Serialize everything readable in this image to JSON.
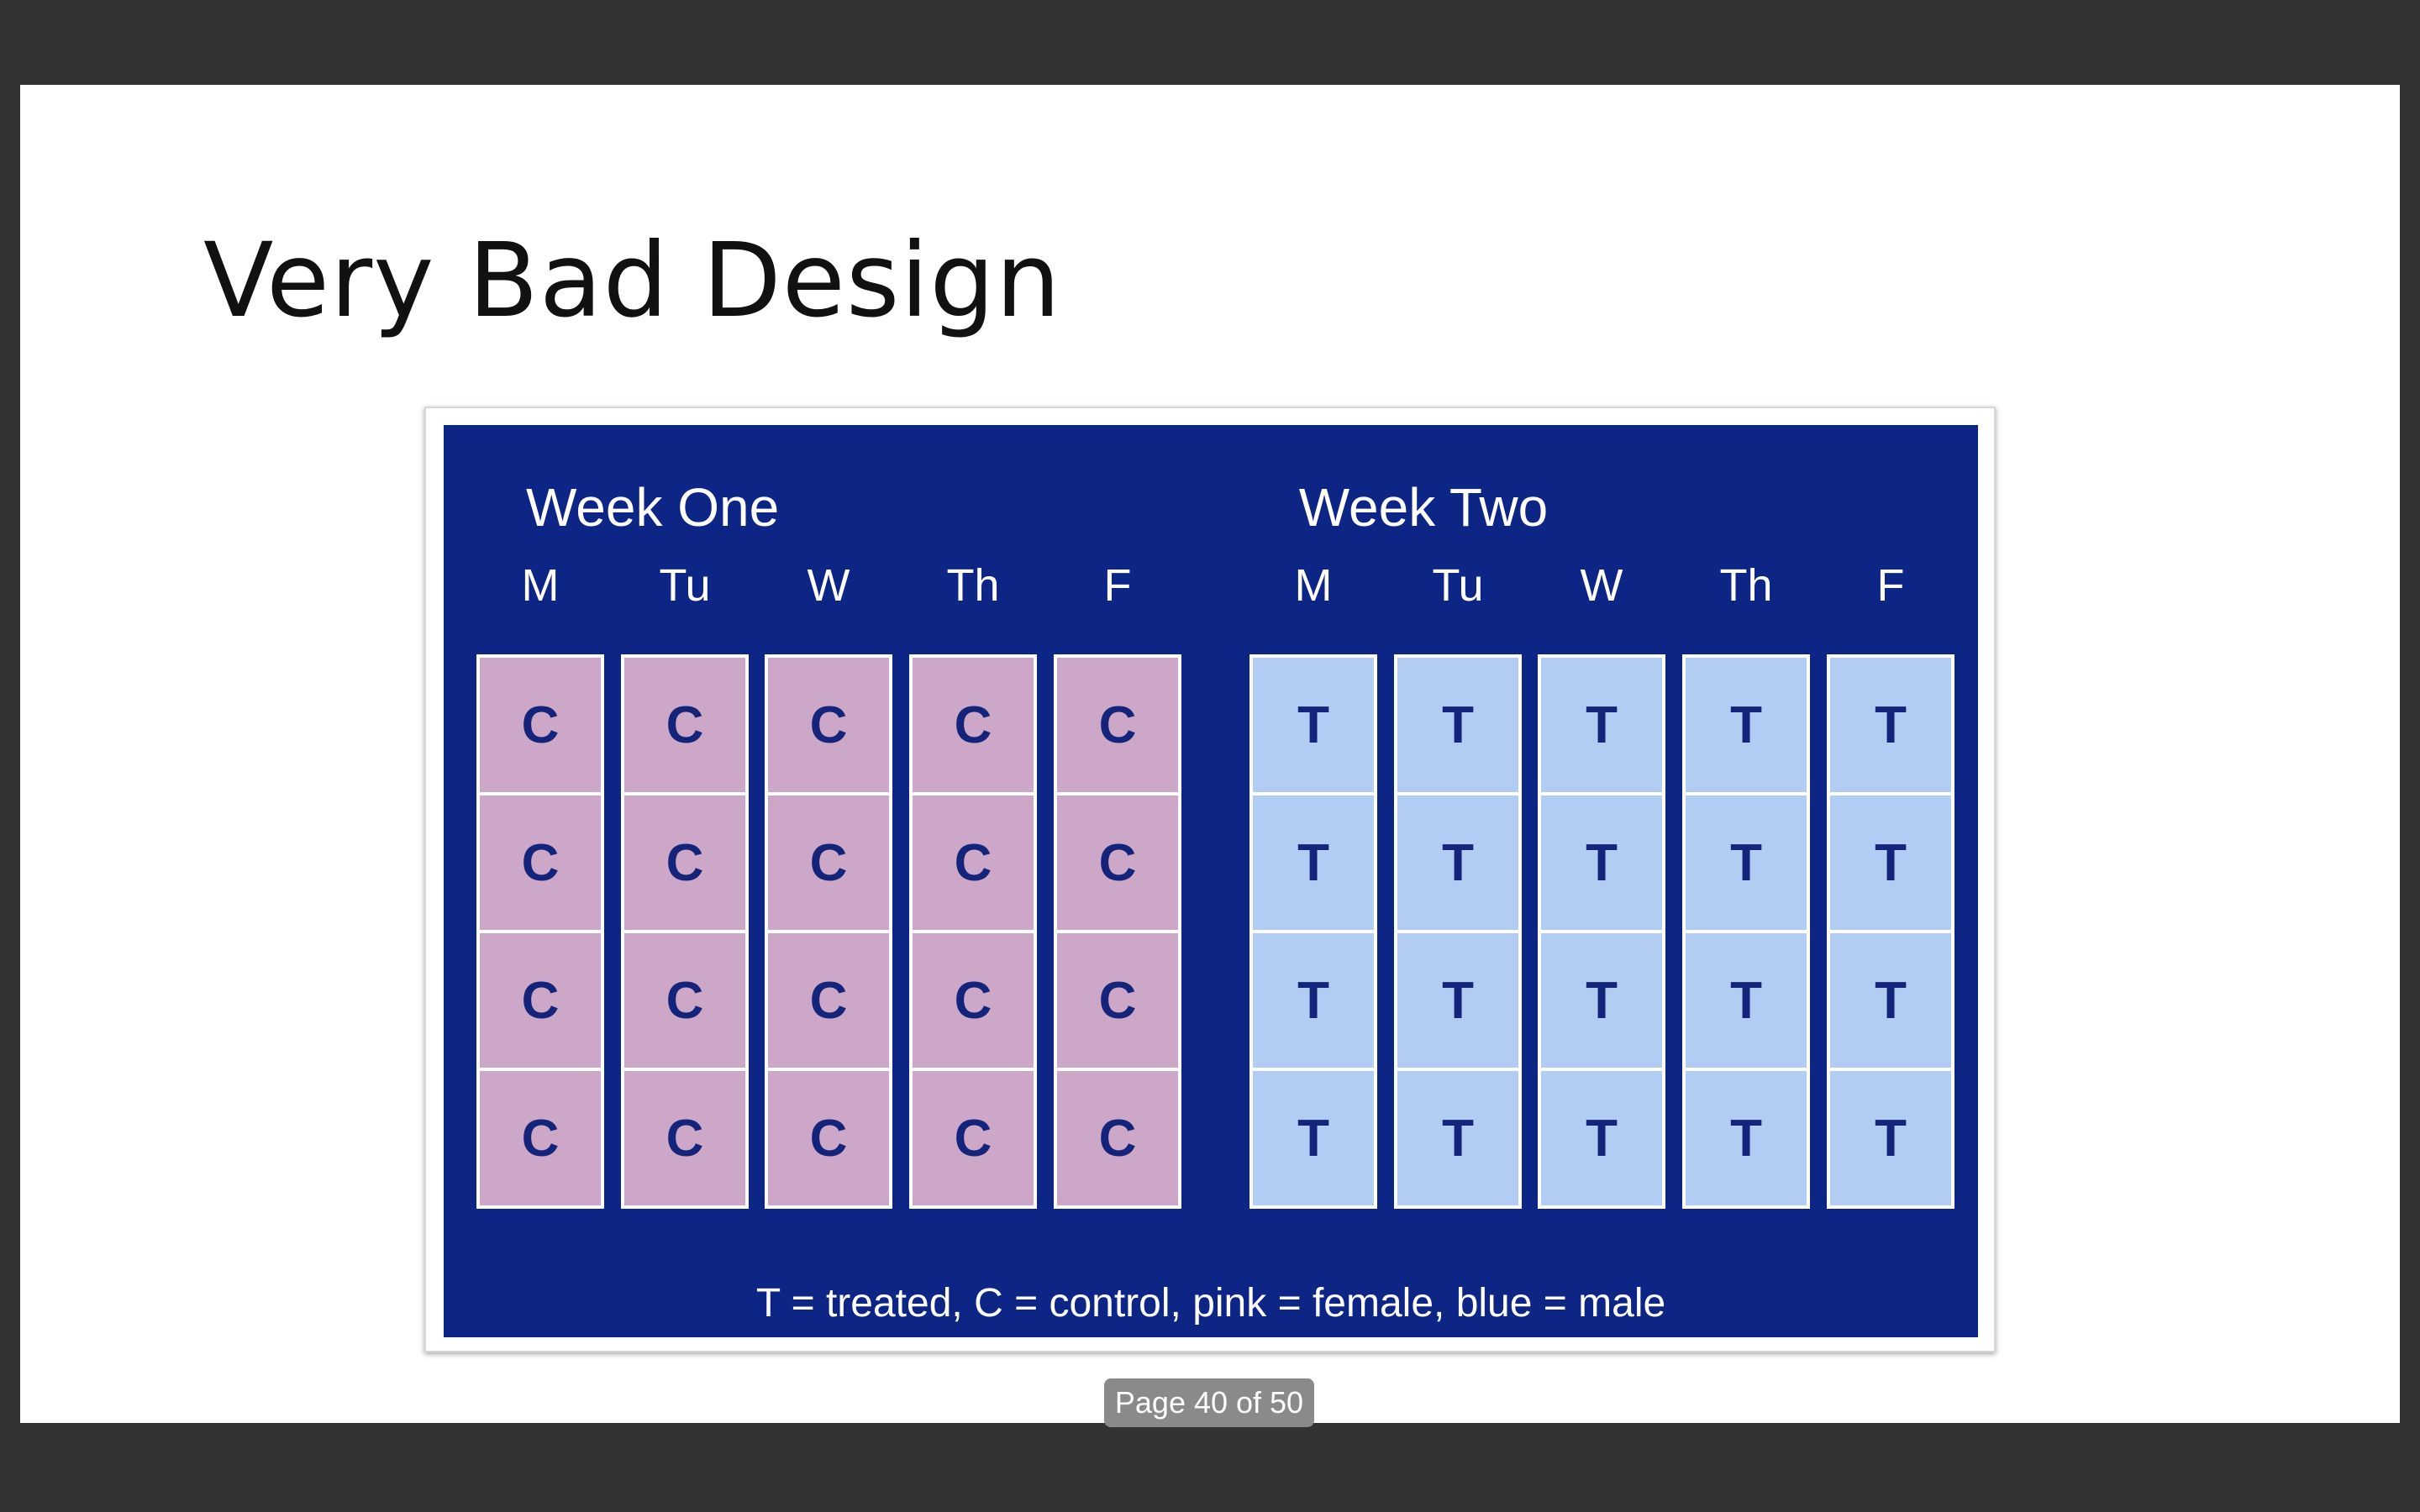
{
  "slide": {
    "title": "Very Bad Design"
  },
  "figure": {
    "weeks": [
      {
        "title": "Week One",
        "days": [
          "M",
          "Tu",
          "W",
          "Th",
          "F"
        ],
        "cells": [
          [
            "C",
            "C",
            "C",
            "C"
          ],
          [
            "C",
            "C",
            "C",
            "C"
          ],
          [
            "C",
            "C",
            "C",
            "C"
          ],
          [
            "C",
            "C",
            "C",
            "C"
          ],
          [
            "C",
            "C",
            "C",
            "C"
          ]
        ],
        "cell_color": "#cda7c7"
      },
      {
        "title": "Week Two",
        "days": [
          "M",
          "Tu",
          "W",
          "Th",
          "F"
        ],
        "cells": [
          [
            "T",
            "T",
            "T",
            "T"
          ],
          [
            "T",
            "T",
            "T",
            "T"
          ],
          [
            "T",
            "T",
            "T",
            "T"
          ],
          [
            "T",
            "T",
            "T",
            "T"
          ],
          [
            "T",
            "T",
            "T",
            "T"
          ]
        ],
        "cell_color": "#b2cdf3"
      }
    ],
    "legend": "T = treated, C = control, pink = female, blue = male",
    "background_color": "#0d2585",
    "letter_color": "#13247a"
  },
  "viewer": {
    "page_indicator": "Page 40 of 50",
    "background_color": "#323232"
  }
}
